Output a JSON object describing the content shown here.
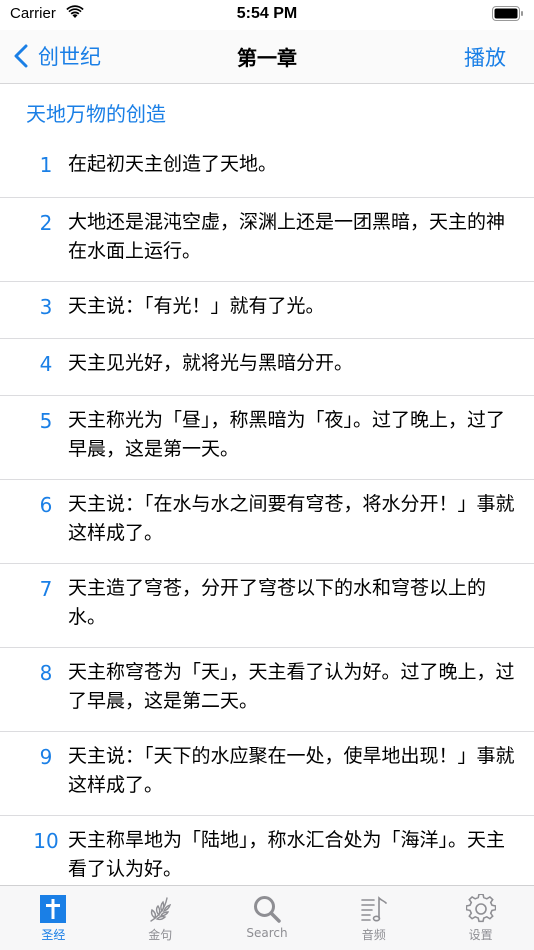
{
  "status": {
    "carrier": "Carrier",
    "time": "5:54 PM"
  },
  "nav": {
    "back_label": "创世纪",
    "title": "第一章",
    "action_label": "播放"
  },
  "section": {
    "title": "天地万物的创造"
  },
  "verses": [
    {
      "num": "1",
      "text": "在起初天主创造了天地。"
    },
    {
      "num": "2",
      "text": "大地还是混沌空虚，深渊上还是一团黑暗，天主的神在水面上运行。"
    },
    {
      "num": "3",
      "text": "天主说：「有光！」就有了光。"
    },
    {
      "num": "4",
      "text": "天主见光好，就将光与黑暗分开。"
    },
    {
      "num": "5",
      "text": "天主称光为「昼」，称黑暗为「夜」。过了晚上，过了早晨，这是第一天。"
    },
    {
      "num": "6",
      "text": "天主说：「在水与水之间要有穹苍，将水分开！」事就这样成了。"
    },
    {
      "num": "7",
      "text": "天主造了穹苍，分开了穹苍以下的水和穹苍以上的水。"
    },
    {
      "num": "8",
      "text": "天主称穹苍为「天」，天主看了认为好。过了晚上，过了早晨，这是第二天。"
    },
    {
      "num": "9",
      "text": "天主说：「天下的水应聚在一处，使旱地出现！」事就这样成了。"
    },
    {
      "num": "10",
      "text": "天主称旱地为「陆地」，称水汇合处为「海洋」。天主看了认为好。"
    }
  ],
  "tabs": [
    {
      "label": "圣经",
      "icon": "cross-book-icon",
      "active": true
    },
    {
      "label": "金句",
      "icon": "laurel-icon",
      "active": false
    },
    {
      "label": "Search",
      "icon": "search-icon",
      "active": false
    },
    {
      "label": "音频",
      "icon": "music-list-icon",
      "active": false
    },
    {
      "label": "设置",
      "icon": "gear-icon",
      "active": false
    }
  ],
  "colors": {
    "accent": "#1a7fe6",
    "inactive": "#8e8e93"
  }
}
